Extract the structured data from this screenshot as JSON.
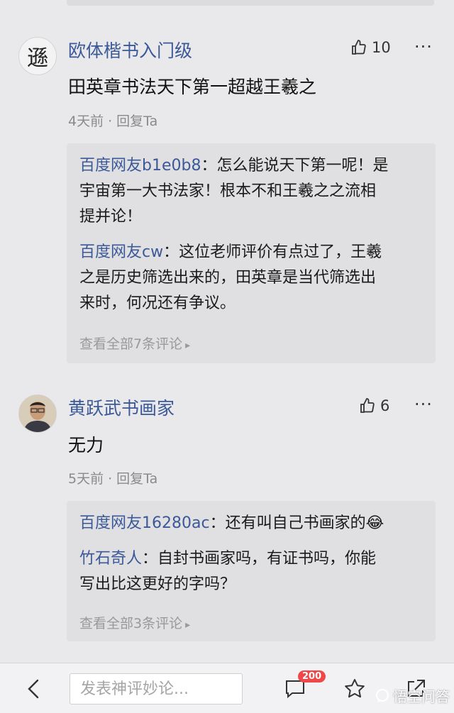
{
  "comments": [
    {
      "author": "欧体楷书入门级",
      "avatar_char": "遜",
      "likes": "10",
      "text": "田英章书法天下第一超越王羲之",
      "time": "4天前",
      "reply_action": "回复Ta",
      "replies": [
        {
          "name": "百度网友b1e0b8",
          "lines": [
            "怎么能说天下第一呢！是",
            "宇宙第一大书法家！根本不和王羲之之流相",
            "提并论！"
          ]
        },
        {
          "name": "百度网友cw",
          "lines": [
            "这位老师评价有点过了，王羲",
            "之是历史筛选出来的，田英章是当代筛选出",
            "来时，何况还有争议。"
          ]
        }
      ],
      "view_all": "查看全部7条评论"
    },
    {
      "author": "黄跃武书画家",
      "likes": "6",
      "text": "无力",
      "time": "5天前",
      "reply_action": "回复Ta",
      "replies": [
        {
          "name": "百度网友16280ac",
          "lines": [
            "还有叫自己书画家的😂"
          ]
        },
        {
          "name": "竹石奇人",
          "lines": [
            "自封书画家吗，有证书吗，你能",
            "写出比这更好的字吗？"
          ]
        }
      ],
      "view_all": "查看全部3条评论"
    }
  ],
  "more_label": "···",
  "bottom_bar": {
    "input_placeholder": "发表神评妙论...",
    "comment_count": "200",
    "watermark": "悟空问答"
  },
  "colors": {
    "accent": "#3b5998",
    "badge": "#f04848",
    "background": "#e9e9eb"
  },
  "icons": [
    "chevron-left-icon",
    "thumbs-up-icon",
    "more-icon",
    "comment-icon",
    "star-icon",
    "share-icon"
  ]
}
